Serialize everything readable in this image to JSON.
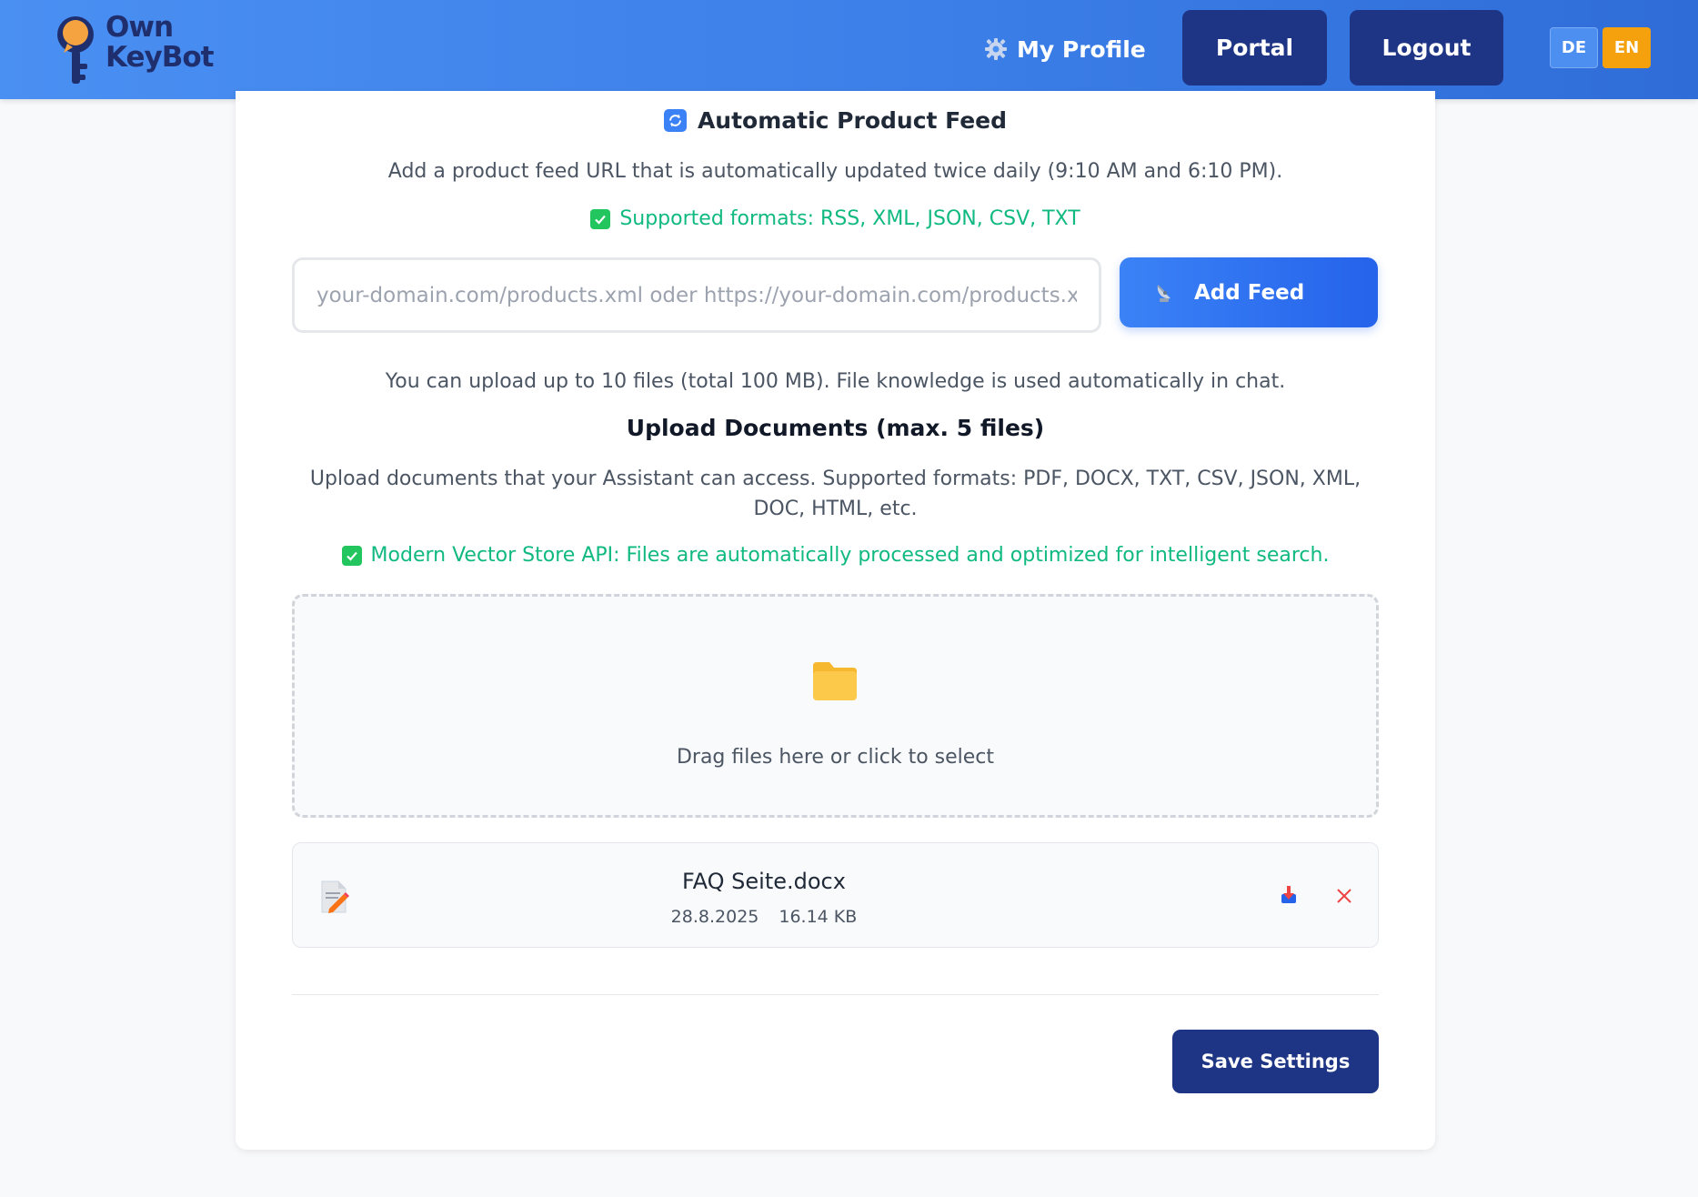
{
  "header": {
    "logo_text_line1": "Own",
    "logo_text_line2": "KeyBot",
    "nav": {
      "profile_icon": "gear-icon",
      "profile_label": "My Profile",
      "portal_label": "Portal",
      "logout_label": "Logout"
    },
    "languages": [
      {
        "code": "DE",
        "active": false
      },
      {
        "code": "EN",
        "active": true
      }
    ]
  },
  "feed": {
    "title_icon": "refresh-icon",
    "title": "Automatic Product Feed",
    "description": "Add a product feed URL that is automatically updated twice daily (9:10 AM and 6:10 PM).",
    "formats_note": "Supported formats: RSS, XML, JSON, CSV, TXT",
    "input_value": "",
    "input_placeholder": "your-domain.com/products.xml oder https://your-domain.com/products.xml",
    "add_button_icon": "satellite-dish-icon",
    "add_button_label": "Add Feed"
  },
  "upload": {
    "limit_note": "You can upload up to 10 files (total 100 MB). File knowledge is used automatically in chat.",
    "title": "Upload Documents (max. 5 files)",
    "description": "Upload documents that your Assistant can access. Supported formats: PDF, DOCX, TXT, CSV, JSON, XML, DOC, HTML, etc.",
    "vector_note": "Modern Vector Store API: Files are automatically processed and optimized for intelligent search.",
    "dropzone_icon": "folder-icon",
    "dropzone_text": "Drag files here or click to select",
    "files": [
      {
        "icon": "document-edit-icon",
        "name": "FAQ Seite.docx",
        "date": "28.8.2025",
        "size": "16.14 KB"
      }
    ]
  },
  "actions": {
    "save_label": "Save Settings"
  },
  "colors": {
    "header_gradient_start": "#4a8ff2",
    "header_gradient_end": "#2f6cd8",
    "nav_button": "#1e3585",
    "accent_blue": "#2563eb",
    "success_green": "#10b981",
    "lang_active": "#f5a10d",
    "remove_red": "#ef4444"
  }
}
